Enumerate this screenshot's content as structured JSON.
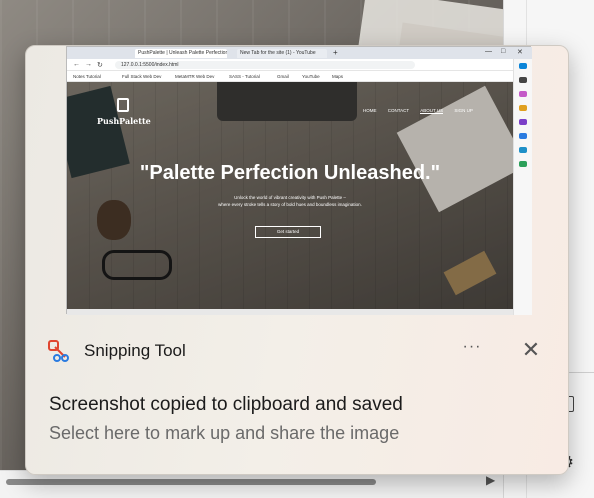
{
  "background": {
    "scroll_arrow": "▶"
  },
  "notification": {
    "app_name": "Snipping Tool",
    "more_label": "···",
    "close_label": "✕",
    "title": "Screenshot copied to clipboard and saved",
    "subtitle": "Select here to mark up and share the image",
    "app_icon": "scissors-icon"
  },
  "preview": {
    "browser": {
      "tabs": [
        "PushPalette | Unleash Palette Perfection",
        "New Tab for the site (1) - YouTube"
      ],
      "new_tab": "+",
      "window_controls": [
        "—",
        "□",
        "✕"
      ],
      "nav": [
        "←",
        "→",
        "↻"
      ],
      "url": "127.0.0.1:5500/index.html",
      "bookmarks": [
        "Notes Tutorial",
        "Full Stack Web Dev",
        "MetaMTR Web Dev",
        "SASS - Tutorial",
        "Gmail",
        "YouTube",
        "Maps"
      ]
    },
    "site": {
      "logo": "PushPalette",
      "nav": [
        "HOME",
        "CONTACT",
        "ABOUT US",
        "SIGN UP"
      ],
      "headline": "\"Palette Perfection Unleashed.\"",
      "sub_line1": "Unlock the world of vibrant creativity with Push Palette –",
      "sub_line2": "where every stroke tells a story of bold hues and boundless imagination.",
      "cta": "Get started"
    }
  }
}
